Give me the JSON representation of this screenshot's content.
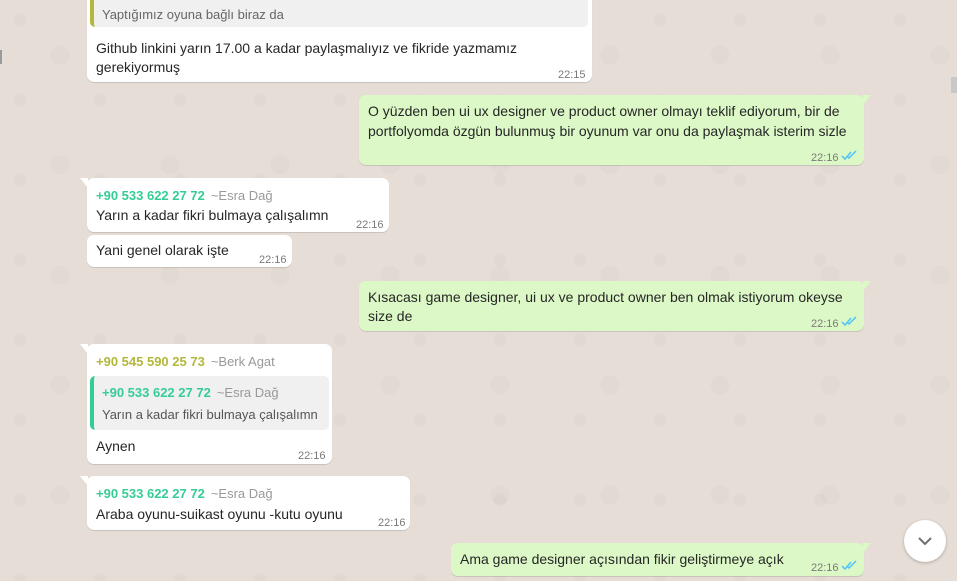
{
  "messages": [
    {
      "direction": "in",
      "quote": {
        "text": "Yaptığımız oyuna bağlı biraz da"
      },
      "text": "Github linkini yarın 17.00 a kadar paylaşmalıyız ve fikride yazmamız gerekiyormuş",
      "text_line1": "Github linkini yarın 17.00 a kadar paylaşmalıyız ve fikride yazmamız",
      "text_line2": "gerekiyormuş",
      "time": "22:15"
    },
    {
      "direction": "out",
      "text_line1": "O yüzden ben ui ux designer ve product owner olmayı teklif ediyorum, bir de",
      "text_line2": "portfolyomda özgün bulunmuş bir oyunum var onu da paylaşmak isterim sizle",
      "time": "22:16",
      "status": "read"
    },
    {
      "direction": "in",
      "sender_phone": "+90 533 622 27 72",
      "sender_name": "~Esra Dağ",
      "text": "Yarın a kadar fikri bulmaya çalışalımn",
      "time": "22:16"
    },
    {
      "direction": "in",
      "text": "Yani genel olarak işte",
      "time": "22:16"
    },
    {
      "direction": "out",
      "text_line1": "Kısacası game designer, ui ux ve product owner ben olmak istiyorum okeyse",
      "text_line2": "size de",
      "time": "22:16",
      "status": "read"
    },
    {
      "direction": "in",
      "sender_phone": "+90 545 590 25 73",
      "sender_name": "~Berk Agat",
      "quote": {
        "sender_phone": "+90 533 622 27 72",
        "sender_name": "~Esra Dağ",
        "text": "Yarın a kadar fikri bulmaya çalışalımn"
      },
      "text": "Aynen",
      "time": "22:16"
    },
    {
      "direction": "in",
      "sender_phone": "+90 533 622 27 72",
      "sender_name": "~Esra Dağ",
      "text": "Araba oyunu-suikast oyunu -kutu oyunu",
      "time": "22:16"
    },
    {
      "direction": "out",
      "text": "Ama game designer açısından fikir geliştirmeye açık",
      "time": "22:16",
      "status": "read"
    }
  ],
  "colors": {
    "incoming_bubble": "#ffffff",
    "outgoing_bubble": "#dcf8c6",
    "sender_esra": "#35cd96",
    "sender_berk": "#b3b73a",
    "read_check": "#4fc3f7"
  },
  "icons": {
    "read_receipt": "double-check-icon",
    "scroll_down": "chevron-down-icon"
  }
}
